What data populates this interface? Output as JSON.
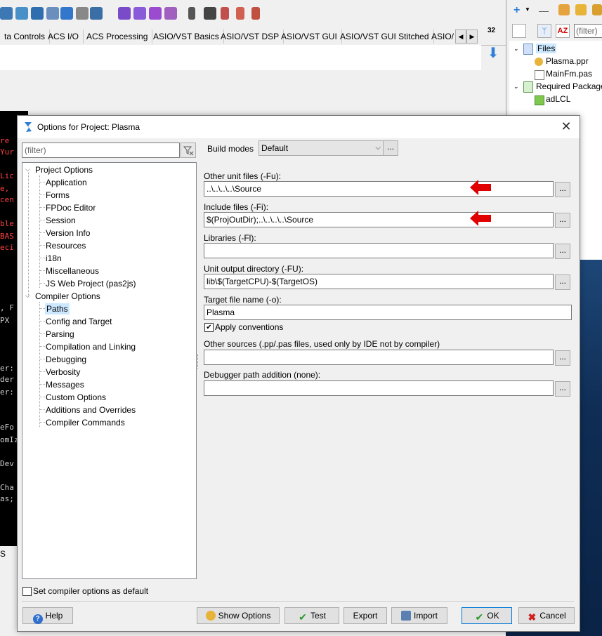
{
  "ide": {
    "tabs": [
      "ta Controls",
      "ACS I/O",
      "ACS Processing",
      "ASIO/VST Basics",
      "ASIO/VST DSP",
      "ASIO/VST GUI",
      "ASIO/VST GUI Stitched",
      "ASIO/"
    ],
    "badge_32": "32",
    "editor_lines": [
      "re",
      "Yur",
      "Lic",
      "e,",
      "cen",
      "ble",
      "BAS",
      "eci",
      ", F",
      " PX",
      "er:",
      "der",
      "er:",
      "eFo",
      "omIz",
      "Dev",
      "Cha",
      "as;"
    ],
    "bottom_text": "S"
  },
  "inspector": {
    "filter_placeholder": "(filter)",
    "items": [
      "Files",
      "Plasma.ppr",
      "MainFm.pas",
      "Required Package",
      "adLCL"
    ]
  },
  "dialog": {
    "title": "Options for Project: Plasma",
    "close": "✕",
    "filter_placeholder": "(filter)",
    "tree": {
      "project_options": "Project Options",
      "project_children": [
        "Application",
        "Forms",
        "FPDoc Editor",
        "Session",
        "Version Info",
        "Resources",
        "i18n",
        "Miscellaneous",
        "JS Web Project (pas2js)"
      ],
      "compiler_options": "Compiler Options",
      "compiler_children": [
        "Paths",
        "Config and Target",
        "Parsing",
        "Compilation and Linking",
        "Debugging",
        "Verbosity",
        "Messages",
        "Custom Options",
        "Additions and Overrides",
        "Compiler Commands"
      ],
      "selected": "Paths"
    },
    "build_modes": {
      "label": "Build modes",
      "value": "Default",
      "more": "..."
    },
    "fields": [
      {
        "label": "Other unit files (-Fu):",
        "value": "..\\..\\..\\..\\Source"
      },
      {
        "label": "Include files (-Fi):",
        "value": "$(ProjOutDir);..\\..\\..\\..\\Source"
      },
      {
        "label": "Libraries (-Fl):",
        "value": ""
      },
      {
        "label": "Unit output directory (-FU):",
        "value": "lib\\$(TargetCPU)-$(TargetOS)"
      }
    ],
    "target": {
      "label": "Target file name (-o):",
      "value": "Plasma"
    },
    "apply_conventions": {
      "label": "Apply conventions",
      "checked": true,
      "mark": "✔"
    },
    "other_sources": {
      "label": "Other sources (.pp/.pas files, used only by IDE not by compiler)",
      "value": ""
    },
    "debugger_path": {
      "label": "Debugger path addition (none):",
      "value": ""
    },
    "ellipsis": "...",
    "set_default": {
      "label": "Set compiler options as default",
      "checked": false
    },
    "buttons": {
      "help": "Help",
      "show_options": "Show Options",
      "test": "Test",
      "export": "Export",
      "import": "Import",
      "ok": "OK",
      "cancel": "Cancel"
    },
    "colors": {
      "arrow": "#e00000",
      "selection": "#cce8ff",
      "ok_border": "#0078d7"
    }
  }
}
